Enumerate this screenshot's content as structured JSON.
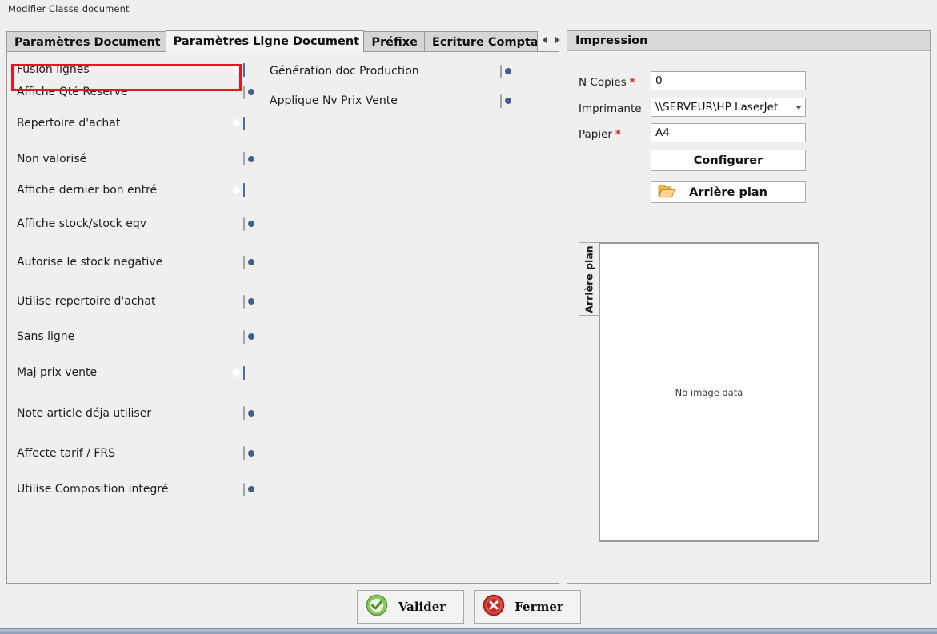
{
  "window": {
    "title": "Modifier Classe document"
  },
  "tabs": {
    "items": [
      {
        "label": "Paramètres Document",
        "active": false
      },
      {
        "label": "Paramètres Ligne Document",
        "active": true
      },
      {
        "label": "Préfixe",
        "active": false
      },
      {
        "label": "Ecriture Comptable",
        "active": false
      }
    ],
    "scroll_left_icon": "triangle-left-icon",
    "scroll_right_icon": "triangle-right-icon"
  },
  "line_settings": {
    "left_column": [
      {
        "label": "Fusion lignes",
        "state": "on",
        "highlighted": true
      },
      {
        "label": "Affiche Qté Reserve",
        "state": "off",
        "highlighted": false
      },
      {
        "label": "Repertoire d'achat",
        "state": "on",
        "highlighted": false
      },
      {
        "label": "Non valorisé",
        "state": "off",
        "highlighted": false
      },
      {
        "label": "Affiche dernier bon entré",
        "state": "on",
        "highlighted": false
      },
      {
        "label": "Affiche stock/stock eqv",
        "state": "off",
        "highlighted": false
      },
      {
        "label": "Autorise le stock negative",
        "state": "off",
        "highlighted": false
      },
      {
        "label": "Utilise repertoire d'achat",
        "state": "off",
        "highlighted": false
      },
      {
        "label": "Sans ligne",
        "state": "off",
        "highlighted": false
      },
      {
        "label": "Maj prix vente",
        "state": "on",
        "highlighted": false
      },
      {
        "label": "Note article déja utiliser",
        "state": "off",
        "highlighted": false
      },
      {
        "label": "Affecte tarif / FRS",
        "state": "off",
        "highlighted": false
      },
      {
        "label": "Utilise Composition integré",
        "state": "off",
        "highlighted": false
      }
    ],
    "middle_column": [
      {
        "label": "Génération doc Production",
        "state": "off"
      },
      {
        "label": "Applique Nv Prix Vente",
        "state": "off"
      }
    ]
  },
  "impression": {
    "header": "Impression",
    "n_copies": {
      "label": "N Copies",
      "required_marker": "*",
      "value": "0",
      "placeholder": ""
    },
    "imprimante": {
      "label": "Imprimante",
      "value": "\\\\SERVEUR\\HP LaserJet",
      "caret_icon": "chevron-down-icon"
    },
    "papier": {
      "label": "Papier",
      "required_marker": "*",
      "value": "A4",
      "placeholder": ""
    },
    "configurer_button": "Configurer",
    "arriere_plan_button": {
      "label": "Arrière plan",
      "icon": "folder-open-icon"
    },
    "preview": {
      "vertical_tab": "Arrière plan",
      "empty_text": "No image data"
    }
  },
  "footer": {
    "validate": {
      "label": "Valider",
      "icon": "check-circle-icon"
    },
    "close": {
      "label": "Fermer",
      "icon": "close-circle-icon"
    }
  },
  "colors": {
    "toggle_on": "#4e6c9c",
    "highlight_border": "#e8161a",
    "required_marker": "#d81f1f",
    "window_bg": "#efefef",
    "tab_active_bg": "#f4f4f4",
    "tab_inactive_bg": "#d6d6d6"
  }
}
